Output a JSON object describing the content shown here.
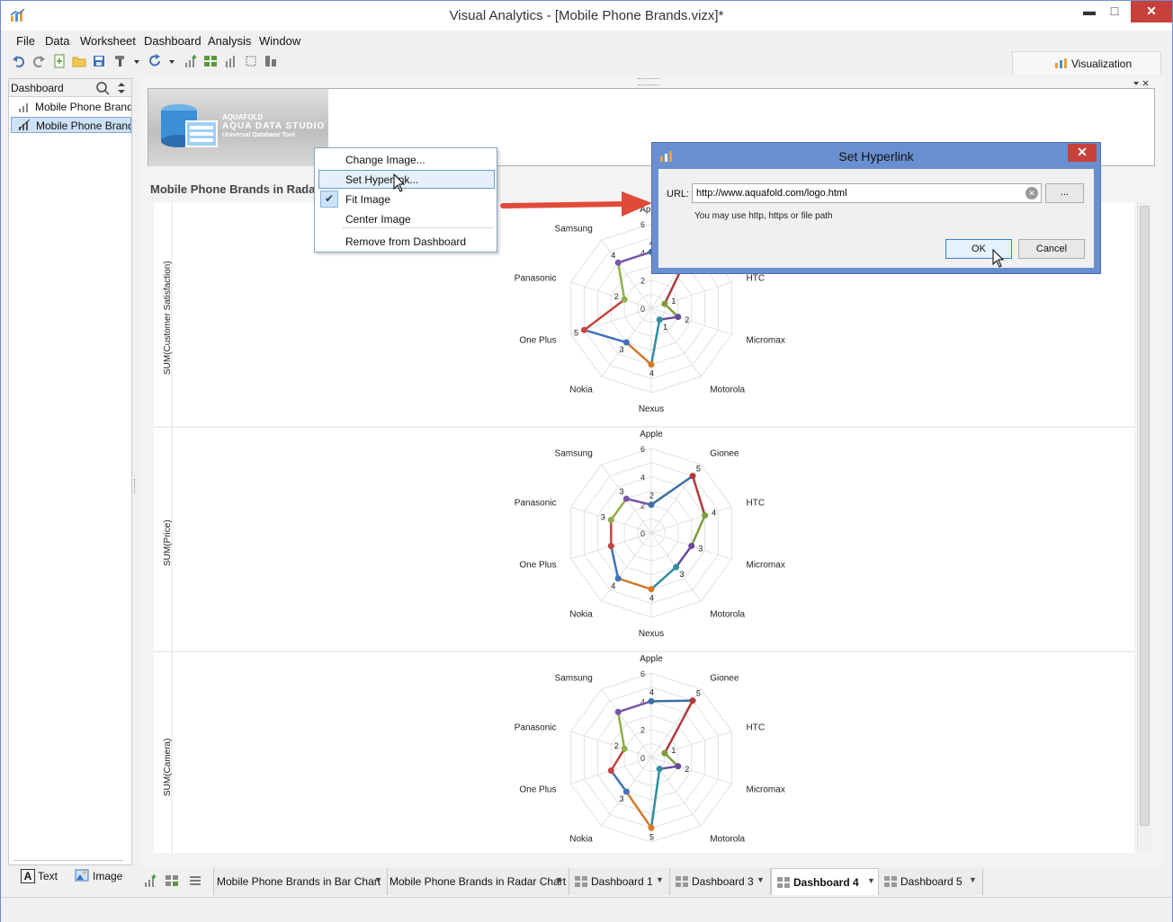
{
  "window": {
    "title": "Visual Analytics - [Mobile Phone Brands.vizx]*",
    "minimize": "▬",
    "maximize": "□",
    "close": "✕"
  },
  "menu": [
    "File",
    "Data",
    "Worksheet",
    "Dashboard",
    "Analysis",
    "Window"
  ],
  "visualization_tab": "Visualization",
  "left_panel": {
    "header": "Dashboard",
    "items": [
      "Mobile Phone Brands in Bar Chart",
      "Mobile Phone Brands in Radar Chart"
    ],
    "add_text": "Text",
    "add_image": "Image"
  },
  "logo": {
    "brand": "AQUAFOLD",
    "product": "AQUA DATA STUDIO",
    "tagline": "Universal Database Tool"
  },
  "chart_title": "Mobile Phone Brands in Radar",
  "context_menu": {
    "items": [
      "Change Image...",
      "Set Hyperlink...",
      "Fit Image",
      "Center Image",
      "Remove from Dashboard"
    ],
    "checked": "Fit Image",
    "hovered": "Set Hyperlink..."
  },
  "dialog": {
    "title": "Set Hyperlink",
    "url_label": "URL:",
    "url_value": "http://www.aquafold.com/logo.html",
    "hint": "You may use http, https or file path",
    "browse": "...",
    "ok": "OK",
    "cancel": "Cancel"
  },
  "tabs": [
    {
      "label": "Mobile Phone Brands  in Bar Chart",
      "active": false
    },
    {
      "label": "Mobile Phone Brands in Radar Chart",
      "active": false
    },
    {
      "label": "Dashboard 1",
      "active": false
    },
    {
      "label": "Dashboard 3",
      "active": false
    },
    {
      "label": "Dashboard 4",
      "active": true
    },
    {
      "label": "Dashboard 5",
      "active": false
    }
  ],
  "colors": {
    "accent": "#6a8fd0",
    "close_red": "#c7403a",
    "Apple": "#3c6fa3",
    "Gionee": "#b03a3a",
    "HTC": "#7a9e3a",
    "Micromax": "#6a4a9a",
    "Motorola": "#2e8fa0",
    "Nexus": "#d47a2a",
    "Nokia": "#3f72b8",
    "One Plus": "#c44444",
    "Panasonic": "#8fb04a",
    "Samsung": "#7a55a8"
  },
  "chart_data": {
    "type": "radar",
    "categories": [
      "Apple",
      "Gionee",
      "HTC",
      "Micromax",
      "Motorola",
      "Nexus",
      "Nokia",
      "One Plus",
      "Panasonic",
      "Samsung"
    ],
    "rlim": [
      0,
      6
    ],
    "ticks": [
      0,
      2,
      4,
      6
    ],
    "panels": [
      {
        "ylabel": "SUM(Customer Satisfaction)",
        "values": [
          4,
          4,
          1,
          2,
          1,
          4,
          3,
          5,
          2,
          4
        ],
        "point_labels": [
          "4",
          "",
          "1",
          "2",
          "1",
          "4",
          "3",
          "5",
          "2",
          "4"
        ]
      },
      {
        "ylabel": "SUM(Price)",
        "values": [
          2,
          5,
          4,
          3,
          3,
          4,
          4,
          3,
          3,
          3
        ],
        "point_labels": [
          "2",
          "5",
          "4",
          "3",
          "3",
          "4",
          "4",
          "",
          "3",
          "3"
        ]
      },
      {
        "ylabel": "SUM(Camera)",
        "values": [
          4,
          5,
          1,
          2,
          1,
          5,
          3,
          3,
          2,
          4
        ],
        "point_labels": [
          "4",
          "5",
          "1",
          "2",
          "",
          "5",
          "3",
          "",
          "2",
          ""
        ]
      }
    ]
  }
}
